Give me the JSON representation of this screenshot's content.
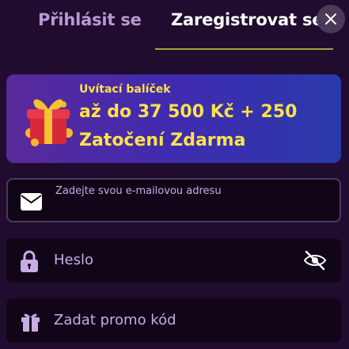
{
  "tabs": {
    "login_label": "Přihlásit se",
    "register_label": "Zaregistrovat se"
  },
  "banner": {
    "subtitle": "Uvítací balíček",
    "line1": "až do 37 500 Kč + 250",
    "line2": "Zatočení Zdarma"
  },
  "form": {
    "email_placeholder": "Zadejte svou e-mailovou adresu",
    "password_placeholder": "Heslo",
    "promo_placeholder": "Zadat promo kód"
  },
  "icons": {
    "close": "close-icon",
    "email": "envelope-icon",
    "lock": "lock-icon",
    "eye": "eye-off-icon",
    "gift": "gift-icon"
  },
  "colors": {
    "background": "#200c2f",
    "accent_yellow": "#ffe24a",
    "tab_inactive": "#b89ad2",
    "field_bg": "#100618"
  }
}
